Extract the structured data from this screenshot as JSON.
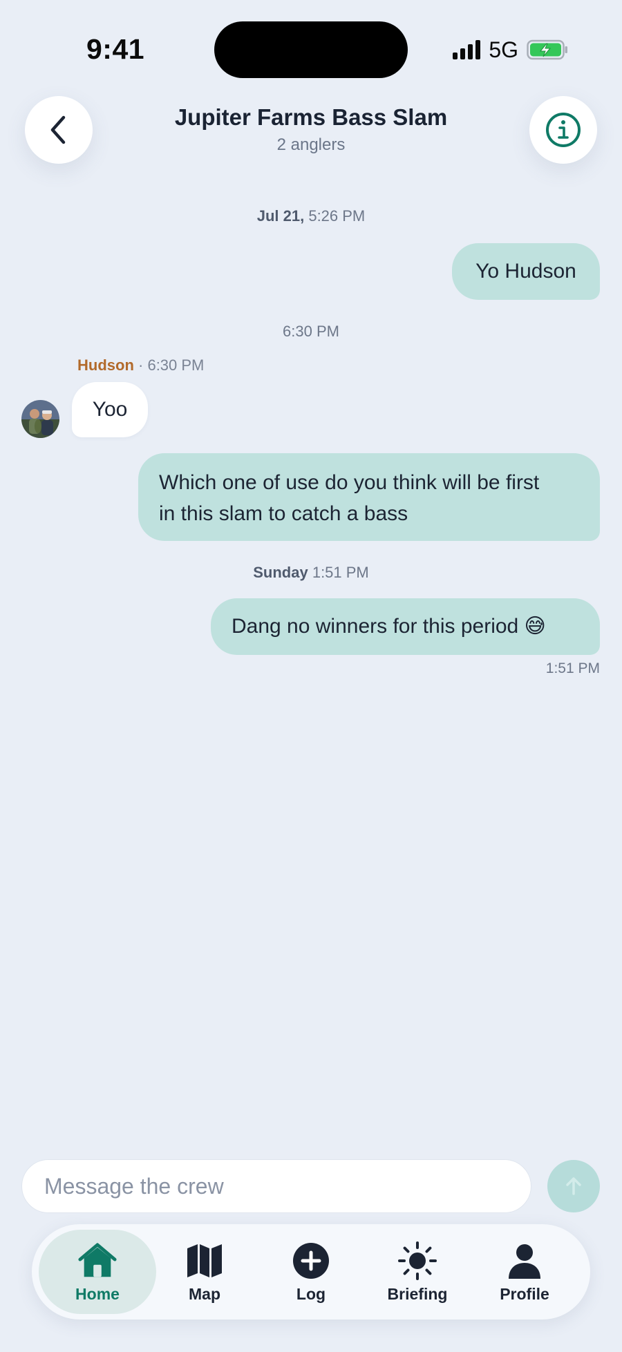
{
  "status_bar": {
    "time": "9:41",
    "network": "5G"
  },
  "header": {
    "title": "Jupiter Farms Bass Slam",
    "subtitle": "2 anglers"
  },
  "chat": {
    "timestamps": [
      {
        "day": "Jul 21,",
        "time": "5:26 PM"
      },
      {
        "day": "",
        "time": "6:30 PM"
      },
      {
        "day": "Sunday",
        "time": "1:51 PM"
      }
    ],
    "messages": [
      {
        "direction": "out",
        "text": "Yo Hudson"
      },
      {
        "direction": "in",
        "sender": "Hudson",
        "time": "· 6:30 PM",
        "text": "Yoo"
      },
      {
        "direction": "out",
        "line1": "Which one of use do you think will be first",
        "line2": "in this slam to catch a bass"
      },
      {
        "direction": "out",
        "text": "Dang no winners for this period 😅"
      }
    ],
    "last_delivered": "1:51 PM"
  },
  "composer": {
    "placeholder": "Message the crew",
    "value": ""
  },
  "tabs": [
    {
      "label": "Home",
      "icon": "home-icon",
      "active": true
    },
    {
      "label": "Map",
      "icon": "map-icon",
      "active": false
    },
    {
      "label": "Log",
      "icon": "plus-circle-icon",
      "active": false
    },
    {
      "label": "Briefing",
      "icon": "sun-icon",
      "active": false
    },
    {
      "label": "Profile",
      "icon": "person-icon",
      "active": false
    }
  ],
  "colors": {
    "background": "#e9eef6",
    "accent": "#0f7a66",
    "outgoing_bubble": "#bfe1de",
    "incoming_bubble": "#ffffff",
    "sender_name": "#b26a2b",
    "battery_charging": "#34c759"
  }
}
